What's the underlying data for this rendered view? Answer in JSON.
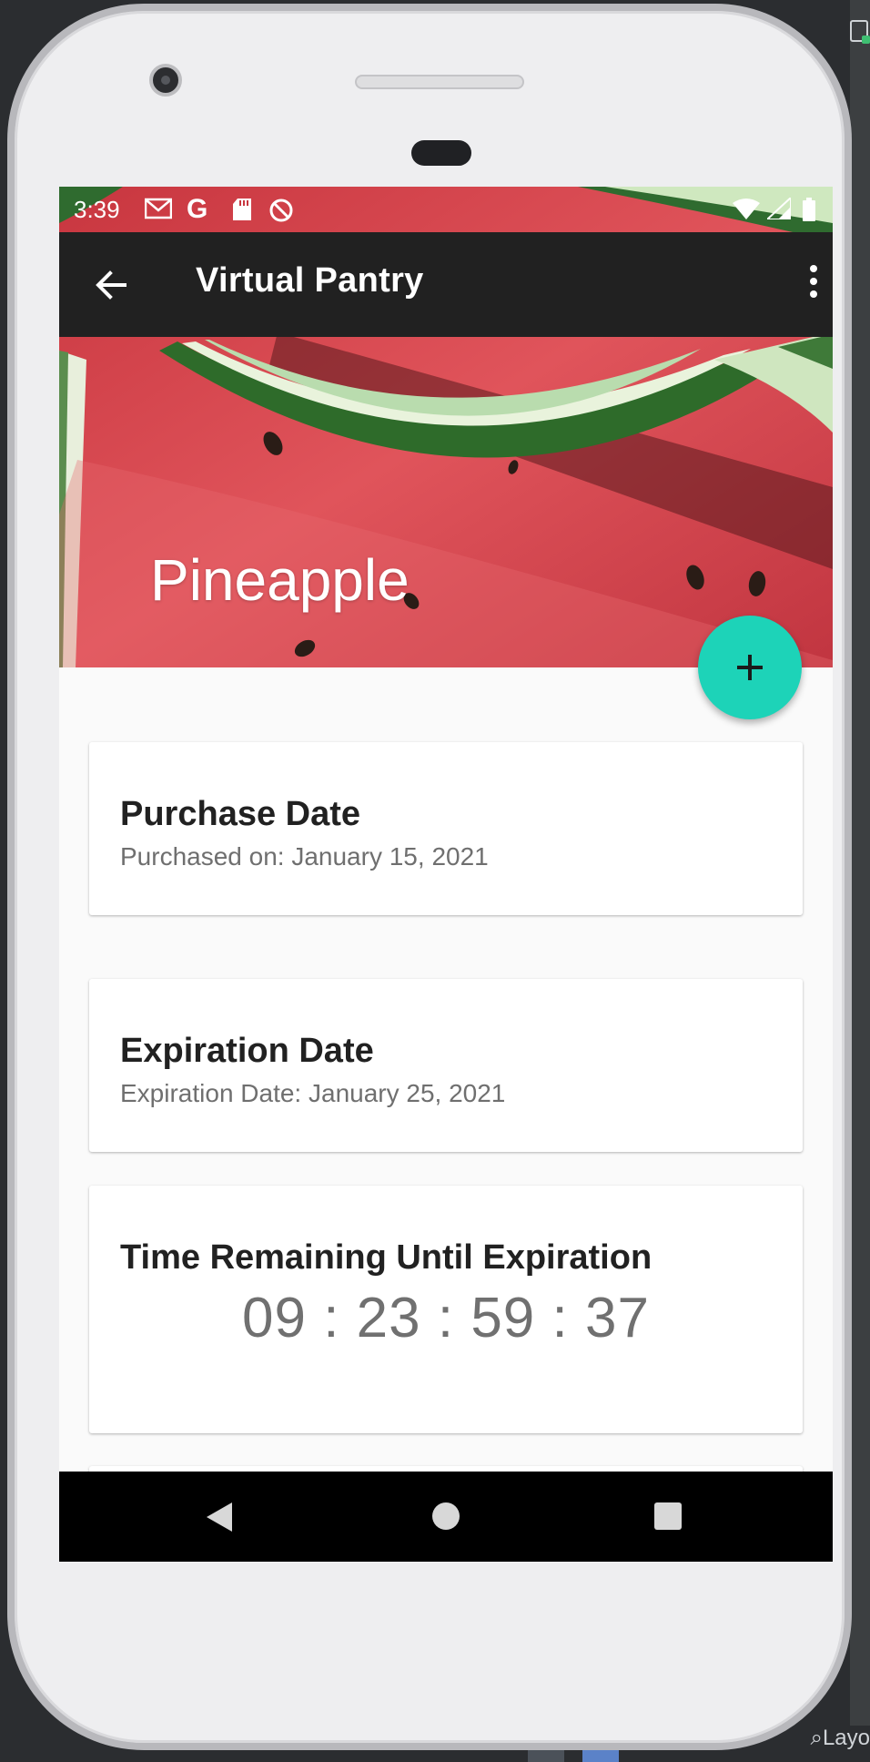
{
  "status_bar": {
    "time": "3:39",
    "icons": [
      "gmail-icon",
      "google-icon",
      "sd-card-icon",
      "do-not-disturb-icon",
      "wifi-icon",
      "signal-icon",
      "battery-icon"
    ]
  },
  "app_bar": {
    "title": "Virtual Pantry",
    "back_icon": "arrow-back-icon",
    "more_icon": "more-vert-icon"
  },
  "header": {
    "item_name": "Pineapple",
    "image": "watermelon-slices"
  },
  "fab": {
    "icon": "add-icon",
    "color": "#1dd3b8"
  },
  "cards": {
    "purchase": {
      "title": "Purchase Date",
      "subtitle": "Purchased on: January 15, 2021"
    },
    "expiration": {
      "title": "Expiration Date",
      "subtitle": "Expiration Date: January 25, 2021"
    },
    "remaining": {
      "title": "Time Remaining Until Expiration",
      "countdown": "09 : 23 : 59 : 37"
    }
  },
  "nav_bar": {
    "icons": [
      "nav-back-icon",
      "nav-home-icon",
      "nav-recents-icon"
    ]
  },
  "ide": {
    "side_label": "Layo"
  },
  "colors": {
    "app_bar": "#212121",
    "accent": "#1dd3b8",
    "nav_bar": "#000000"
  }
}
